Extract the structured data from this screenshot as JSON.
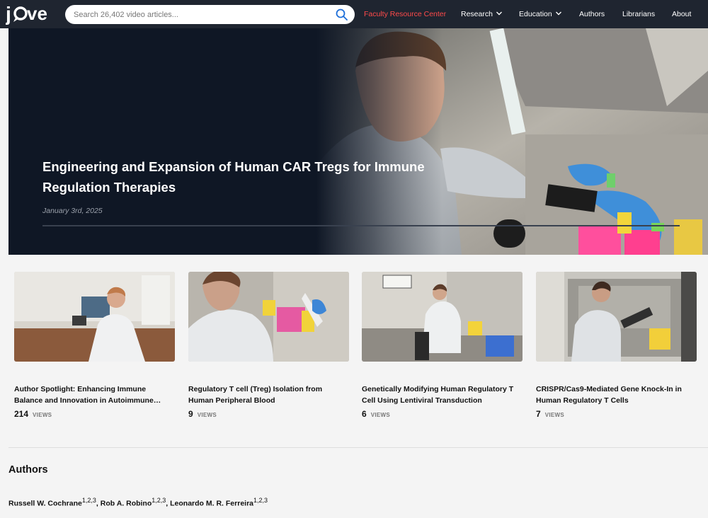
{
  "header": {
    "logo_text": "jove",
    "search_placeholder": "Search 26,402 video articles...",
    "nav": {
      "faculty": "Faculty Resource Center",
      "research": "Research",
      "education": "Education",
      "authors": "Authors",
      "librarians": "Librarians",
      "about": "About"
    },
    "icons": {
      "search": "search-icon",
      "dropdown": "chevron-down-icon"
    },
    "accent_color": "#ff4a4a"
  },
  "hero": {
    "title": "Engineering and Expansion of Human CAR Tregs for Immune Regulation Therapies",
    "date": "January 3rd, 2025"
  },
  "videos": [
    {
      "title": "Author Spotlight: Enhancing Immune Balance and Innovation in Autoimmune…",
      "views": "214",
      "views_label": "VIEWS"
    },
    {
      "title": "Regulatory T cell (Treg) Isolation from Human Peripheral Blood",
      "views": "9",
      "views_label": "VIEWS"
    },
    {
      "title": "Genetically Modifying Human Regulatory T Cell Using Lentiviral Transduction",
      "views": "6",
      "views_label": "VIEWS"
    },
    {
      "title": "CRISPR/Cas9-Mediated Gene Knock-In in Human Regulatory T Cells",
      "views": "7",
      "views_label": "VIEWS"
    }
  ],
  "authors_section": {
    "heading": "Authors",
    "authors": [
      {
        "name": "Russell W. Cochrane",
        "affiliations": "1,2,3"
      },
      {
        "name": "Rob A. Robino",
        "affiliations": "1,2,3"
      },
      {
        "name": "Leonardo M. R. Ferreira",
        "affiliations": "1,2,3"
      }
    ],
    "separator": ", "
  }
}
